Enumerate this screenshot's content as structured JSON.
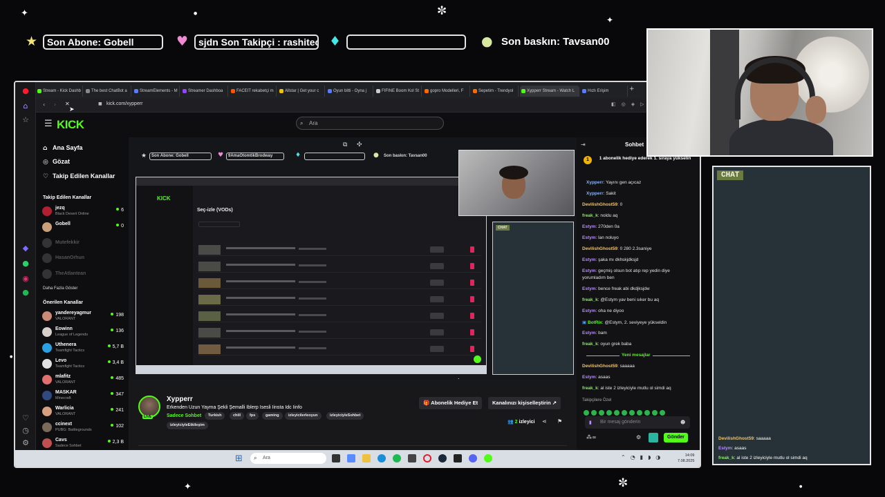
{
  "overlay": {
    "last_sub_label": "Son Abone: Gobell",
    "follower_label": "sjdn    Son Takipçi : rashitec",
    "raid_label": "Son baskın: Tavsan00",
    "chat_label": "CHAT",
    "chat_messages": [
      {
        "user": "DevilishGhost59",
        "sep": ":",
        "text": "saaaaa",
        "color": "#f2c46a"
      },
      {
        "user": "Estym",
        "sep": ":",
        "text": "asaas",
        "color": "#b98cff"
      },
      {
        "user": "freak_k",
        "sep": ":",
        "text": "al iste 2 izleyiciyle mutlu ol simdi aq",
        "color": "#8ee86c"
      }
    ]
  },
  "browser": {
    "tabs": [
      {
        "label": "Stream - Kick Dashb",
        "color": "#53fc18"
      },
      {
        "label": "The best ChatBot a",
        "color": "#888888"
      },
      {
        "label": "StreamElements - M",
        "color": "#5a7cff"
      },
      {
        "label": "Streamer Dashboa",
        "color": "#9147ff"
      },
      {
        "label": "FACEIT rekabetçi m",
        "color": "#ff5500"
      },
      {
        "label": "Allstar | Get your c",
        "color": "#f0c400"
      },
      {
        "label": "Oyun bitti - Oyna j",
        "color": "#5a7cff"
      },
      {
        "label": "FIFINE Boom Kol St",
        "color": "#cccccc"
      },
      {
        "label": "gopro Modelleri, F",
        "color": "#ff6a00"
      },
      {
        "label": "Sepetim - Trendyol",
        "color": "#ff6a00"
      },
      {
        "label": "Xypperr Stream - Watch L",
        "color": "#53fc18"
      },
      {
        "label": "Hızlı Erişim",
        "color": "#5a7cff"
      }
    ],
    "url": "kick.com/xypperr"
  },
  "kick": {
    "logo": "KICK",
    "search_placeholder": "Ara",
    "nav": [
      {
        "icon": "⌂",
        "label": "Ana Sayfa"
      },
      {
        "icon": "◎",
        "label": "Gözat"
      },
      {
        "icon": "♡",
        "label": "Takip Edilen Kanallar"
      }
    ],
    "followed_heading": "Takip Edilen Kanallar",
    "followed": [
      {
        "name": "jezq",
        "game": "Black Desert Online",
        "viewers": "6",
        "online": true
      },
      {
        "name": "Gobell",
        "game": "",
        "viewers": "0",
        "online": true
      },
      {
        "name": "Mutefekkir",
        "game": "",
        "viewers": "",
        "online": false
      },
      {
        "name": "HasanOrhun",
        "game": "",
        "viewers": "",
        "online": false
      },
      {
        "name": "TheAtlantean",
        "game": "",
        "viewers": "",
        "online": false
      }
    ],
    "show_more": "Daha Fazla Göster",
    "recommended_heading": "Önerilen Kanallar",
    "recommended": [
      {
        "name": "yandereyagmur",
        "game": "VALORANT",
        "viewers": "198"
      },
      {
        "name": "Eowinn",
        "game": "League of Legends",
        "viewers": "136"
      },
      {
        "name": "Uthenera",
        "game": "Teamfight Tactics",
        "viewers": "5,7 B"
      },
      {
        "name": "Levo",
        "game": "Teamfight Tactics",
        "viewers": "3,4 B"
      },
      {
        "name": "mlafitz",
        "game": "VALORANT",
        "viewers": "485"
      },
      {
        "name": "MASKAR",
        "game": "Minecraft",
        "viewers": "347"
      },
      {
        "name": "Warlicia",
        "game": "VALORANT",
        "viewers": "241"
      },
      {
        "name": "ccinext",
        "game": "PUBG: Battlegrounds",
        "viewers": "102"
      },
      {
        "name": "Cavs",
        "game": "Sadece Sohbet",
        "viewers": "2,3 B"
      }
    ],
    "player": {
      "mini_sub": "Son Abone: Gobell",
      "mini_follow": "9AmaOtomtikBrodway",
      "mini_raid": "Son baskın: Tavsan00",
      "inner_page_title": "Seç-izle (VODs)",
      "inner_chat_label": "CHAT"
    },
    "stream": {
      "name": "Xypperr",
      "title": "Erkenden Uzun Yayma Şekli Şemalli Iblerp Isesli Iinsta Idc Iinfo",
      "category": "Sadece Sohbet",
      "tags": [
        "Turkish",
        "chill",
        "fps",
        "gaming",
        "izleyicilerleoyun",
        "izleyiciyleSohbet",
        "izleyiciyleEtkileşim"
      ],
      "gift_button": "Abonelik Hediye Et",
      "customize_button": "Kanalınızı kişiselleştirin",
      "viewers": "2",
      "viewers_label": "izleyici",
      "live": "LIVE"
    },
    "chat": {
      "header": "Sohbet",
      "pinned": "1 abonelik hediye ederek 1. sıraya yükselin",
      "messages": [
        {
          "user": "Xypperr",
          "sep": ":",
          "text": "Yayını gen açıcaz",
          "color": "#7fb3ff"
        },
        {
          "user": "Xypperr",
          "sep": ":",
          "text": "Sakit",
          "color": "#7fb3ff"
        },
        {
          "user": "DevilishGhost59",
          "sep": ":",
          "text": "0",
          "color": "#f2c46a"
        },
        {
          "user": "freak_k",
          "sep": ":",
          "text": "noldu aq",
          "color": "#8ee86c"
        },
        {
          "user": "Estym",
          "sep": ":",
          "text": "270den 0a",
          "color": "#b98cff"
        },
        {
          "user": "Estym",
          "sep": ":",
          "text": "lan noluyo",
          "color": "#b98cff"
        },
        {
          "user": "DevilishGhost59",
          "sep": ":",
          "text": "0 280 2.3saniye",
          "color": "#f2c46a"
        },
        {
          "user": "Estym",
          "sep": ":",
          "text": "şaka mı dkhskjdksjd",
          "color": "#b98cff"
        },
        {
          "user": "Estym",
          "sep": ":",
          "text": "geçmiş olsun bot atıp rep yedin diye",
          "color": "#b98cff"
        },
        {
          "user": "",
          "sep": "",
          "text": "yorumladım ben",
          "color": "#b98cff"
        },
        {
          "user": "Estym",
          "sep": ":",
          "text": "bence freak abi dkdjksjdw",
          "color": "#b98cff"
        },
        {
          "user": "freak_k",
          "sep": ":",
          "text": "@Estym yav beni sıker bu aq",
          "color": "#8ee86c"
        },
        {
          "user": "Estym",
          "sep": ":",
          "text": "oha ne diyoo",
          "color": "#b98cff"
        },
        {
          "user": "BotRix",
          "sep": ":",
          "text": "@Estym, 2. seviyeye yükseldin",
          "color": "#53fc18"
        },
        {
          "user": "Estym",
          "sep": ":",
          "text": "bam",
          "color": "#b98cff"
        },
        {
          "user": "freak_k",
          "sep": ":",
          "text": "oyun grek baba",
          "color": "#8ee86c"
        }
      ],
      "new_messages": "Yeni mesajlar",
      "new": [
        {
          "user": "DevilishGhost59",
          "sep": ":",
          "text": "saaaaa",
          "color": "#f2c46a"
        },
        {
          "user": "Estym",
          "sep": ":",
          "text": "asaas",
          "color": "#b98cff"
        },
        {
          "user": "freak_k",
          "sep": ":",
          "text": "al iste 2 izleyiciyle mutlu ol simdi aq",
          "color": "#8ee86c"
        }
      ],
      "followers_only": "Takipçilere Özel",
      "input_placeholder": "Bir mesaj gönderin",
      "send_button": "Gönder"
    }
  },
  "taskbar": {
    "search_placeholder": "Ara",
    "time": "14:09",
    "date": "7.08.2025"
  }
}
